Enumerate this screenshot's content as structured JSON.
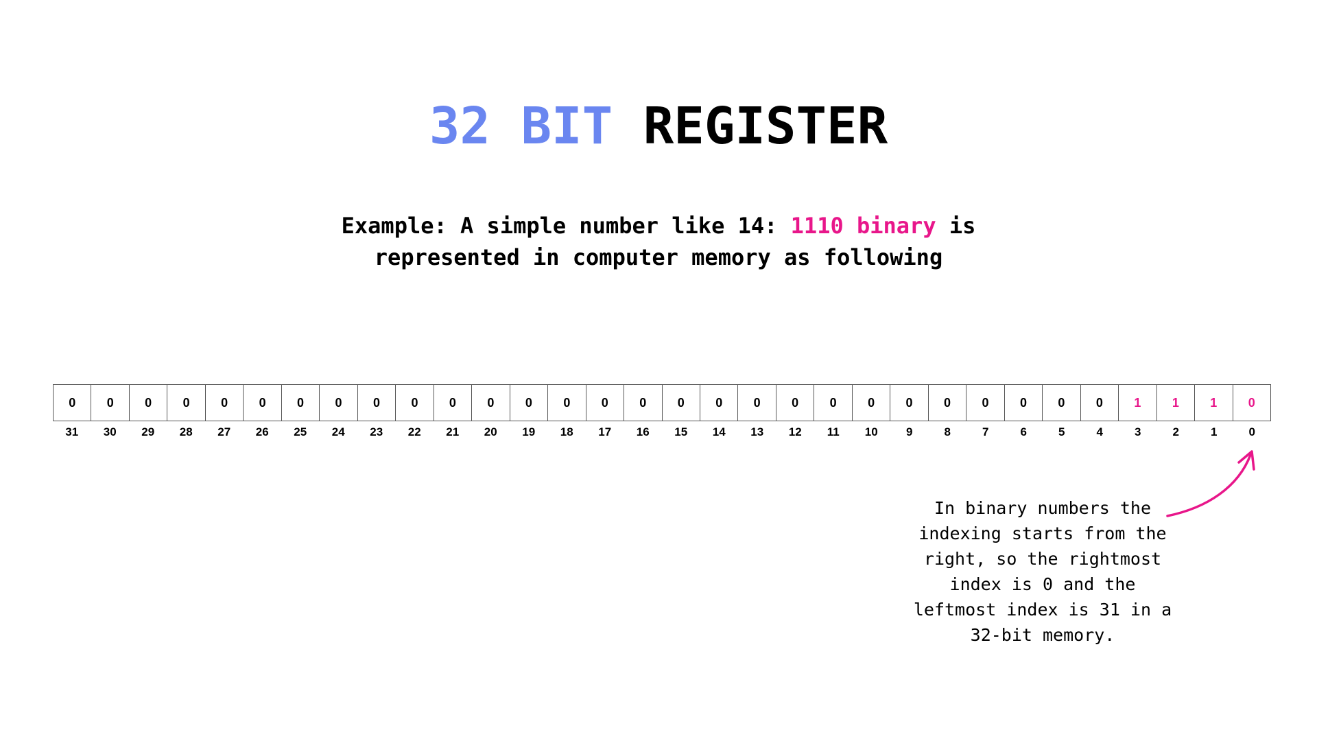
{
  "title": {
    "part1": "32 BIT",
    "part2": "REGISTER",
    "color_part1": "#6a86f0",
    "color_part2": "#000000"
  },
  "subtitle": {
    "line1_prefix": "Example: A simple number like 14: ",
    "line1_highlight": "1110 binary",
    "line1_suffix": " is",
    "line2": "represented in computer memory as following",
    "highlight_color": "#e8168a"
  },
  "register": {
    "bits": [
      {
        "index": "31",
        "value": "0"
      },
      {
        "index": "30",
        "value": "0"
      },
      {
        "index": "29",
        "value": "0"
      },
      {
        "index": "28",
        "value": "0"
      },
      {
        "index": "27",
        "value": "0"
      },
      {
        "index": "26",
        "value": "0"
      },
      {
        "index": "25",
        "value": "0"
      },
      {
        "index": "24",
        "value": "0"
      },
      {
        "index": "23",
        "value": "0"
      },
      {
        "index": "22",
        "value": "0"
      },
      {
        "index": "21",
        "value": "0"
      },
      {
        "index": "20",
        "value": "0"
      },
      {
        "index": "19",
        "value": "0"
      },
      {
        "index": "18",
        "value": "0"
      },
      {
        "index": "17",
        "value": "0"
      },
      {
        "index": "16",
        "value": "0"
      },
      {
        "index": "15",
        "value": "0"
      },
      {
        "index": "14",
        "value": "0"
      },
      {
        "index": "13",
        "value": "0"
      },
      {
        "index": "12",
        "value": "0"
      },
      {
        "index": "11",
        "value": "0"
      },
      {
        "index": "10",
        "value": "0"
      },
      {
        "index": "9",
        "value": "0"
      },
      {
        "index": "8",
        "value": "0"
      },
      {
        "index": "7",
        "value": "0"
      },
      {
        "index": "6",
        "value": "0"
      },
      {
        "index": "5",
        "value": "0"
      },
      {
        "index": "4",
        "value": "0"
      },
      {
        "index": "3",
        "value": "1",
        "highlight": true
      },
      {
        "index": "2",
        "value": "1",
        "highlight": true
      },
      {
        "index": "1",
        "value": "1",
        "highlight": true
      },
      {
        "index": "0",
        "value": "0",
        "highlight": true
      }
    ],
    "highlight_color": "#e8168a"
  },
  "annotation": {
    "lines": [
      "In binary numbers the",
      "indexing starts from the",
      "right, so the rightmost",
      "index is 0 and the",
      "leftmost index is 31 in a",
      "32-bit memory."
    ],
    "arrow_color": "#e8168a",
    "arrow_icon": "curved-arrow-icon"
  }
}
